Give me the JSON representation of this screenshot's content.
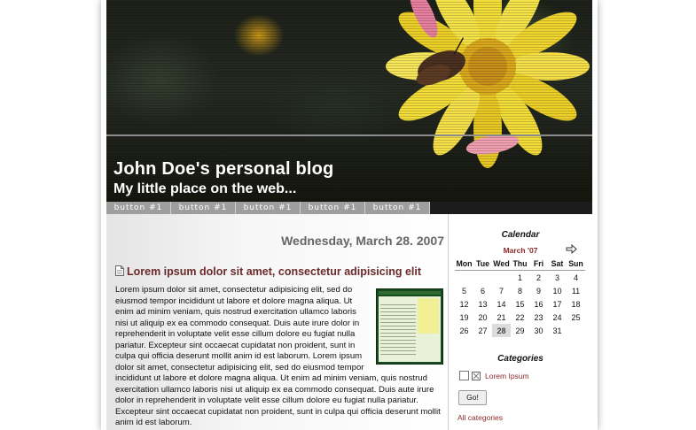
{
  "header": {
    "title": "John Doe's personal blog",
    "subtitle": "My little place on the web..."
  },
  "nav": {
    "buttons": [
      "button #1",
      "button #1",
      "button #1",
      "button #1",
      "button #1"
    ]
  },
  "main": {
    "date": "Wednesday, March 28. 2007",
    "post": {
      "icon": "document-icon",
      "title": "Lorem ipsum dolor sit amet, consectetur adipisicing elit",
      "body": "Lorem ipsum dolor sit amet, consectetur adipisicing elit, sed do eiusmod tempor incididunt ut labore et dolore magna aliqua. Ut enim ad minim veniam, quis nostrud exercitation ullamco laboris nisi ut aliquip ex ea commodo consequat. Duis aute irure dolor in reprehenderit in voluptate velit esse cillum dolore eu fugiat nulla pariatur. Excepteur sint occaecat cupidatat non proident, sunt in culpa qui officia deserunt mollit anim id est laborum. Lorem ipsum dolor sit amet, consectetur adipisicing elit, sed do eiusmod tempor incididunt ut labore et dolore magna aliqua. Ut enim ad minim veniam, quis nostrud exercitation ullamco laboris nisi ut aliquip ex ea commodo consequat. Duis aute irure dolor in reprehenderit in voluptate velit esse cillum dolore eu fugiat nulla pariatur. Excepteur sint occaecat cupidatat non proident, sunt in culpa qui officia deserunt mollit anim id est laborum."
    }
  },
  "sidebar": {
    "calendar": {
      "heading": "Calendar",
      "month": "March '07",
      "next_icon": "arrow-right-icon",
      "weekdays": [
        "Mon",
        "Tue",
        "Wed",
        "Thu",
        "Fri",
        "Sat",
        "Sun"
      ],
      "weeks": [
        [
          "",
          "",
          "",
          "1",
          "2",
          "3",
          "4"
        ],
        [
          "5",
          "6",
          "7",
          "8",
          "9",
          "10",
          "11"
        ],
        [
          "12",
          "13",
          "14",
          "15",
          "16",
          "17",
          "18"
        ],
        [
          "19",
          "20",
          "21",
          "22",
          "23",
          "24",
          "25"
        ],
        [
          "26",
          "27",
          "28",
          "29",
          "30",
          "31",
          ""
        ]
      ],
      "highlighted_day": "28"
    },
    "categories": {
      "heading": "Categories",
      "items": [
        {
          "label": "Lorem Ipsum",
          "icon": "xml-feed-icon"
        }
      ],
      "go_label": "Go!",
      "all_label": "All categories"
    }
  },
  "colors": {
    "link": "#8b2b2b",
    "post_title": "#6b2a2a",
    "nav_button": "#9e9e9e"
  }
}
